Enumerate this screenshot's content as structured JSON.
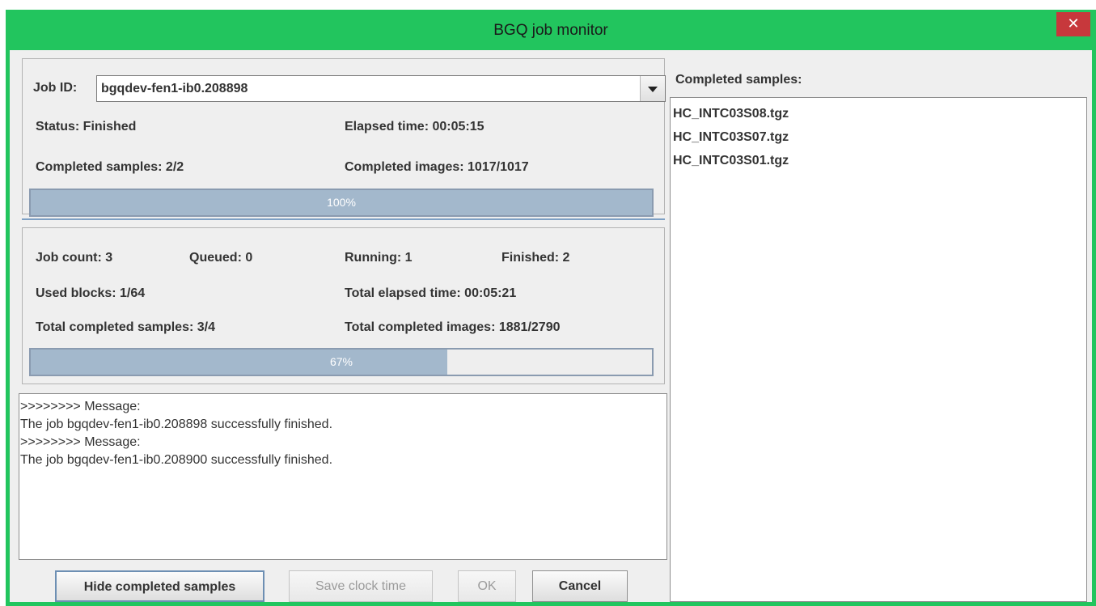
{
  "window": {
    "title": "BGQ job monitor",
    "close_glyph": "✕"
  },
  "job": {
    "label": "Job ID:",
    "selected_id": "bgqdev-fen1-ib0.208898",
    "status": "Status: Finished",
    "elapsed": "Elapsed time: 00:05:15",
    "completed_samples": "Completed samples: 2/2",
    "completed_images": "Completed images: 1017/1017",
    "progress_text": "100%",
    "progress_fraction": 1.0
  },
  "summary": {
    "job_count": "Job count: 3",
    "queued": "Queued: 0",
    "running": "Running: 1",
    "finished": "Finished: 2",
    "used_blocks": "Used blocks: 1/64",
    "total_elapsed": "Total elapsed time: 00:05:21",
    "total_samples": "Total completed samples: 3/4",
    "total_images": "Total completed images: 1881/2790",
    "progress_text": "67%",
    "progress_fraction": 0.67
  },
  "log": {
    "lines": [
      ">>>>>>>> Message:",
      "The job bgqdev-fen1-ib0.208898 successfully finished.",
      ">>>>>>>> Message:",
      "The job bgqdev-fen1-ib0.208900 successfully finished."
    ]
  },
  "buttons": {
    "hide": "Hide completed samples",
    "save": "Save clock time",
    "ok": "OK",
    "cancel": "Cancel"
  },
  "completed_panel": {
    "title": "Completed samples:",
    "items": [
      "HC_INTC03S08.tgz",
      "HC_INTC03S07.tgz",
      "HC_INTC03S01.tgz"
    ]
  },
  "colors": {
    "title_bar": "#22c55e",
    "close_button": "#c7383c",
    "progress_fill": "#a3b8cc"
  }
}
